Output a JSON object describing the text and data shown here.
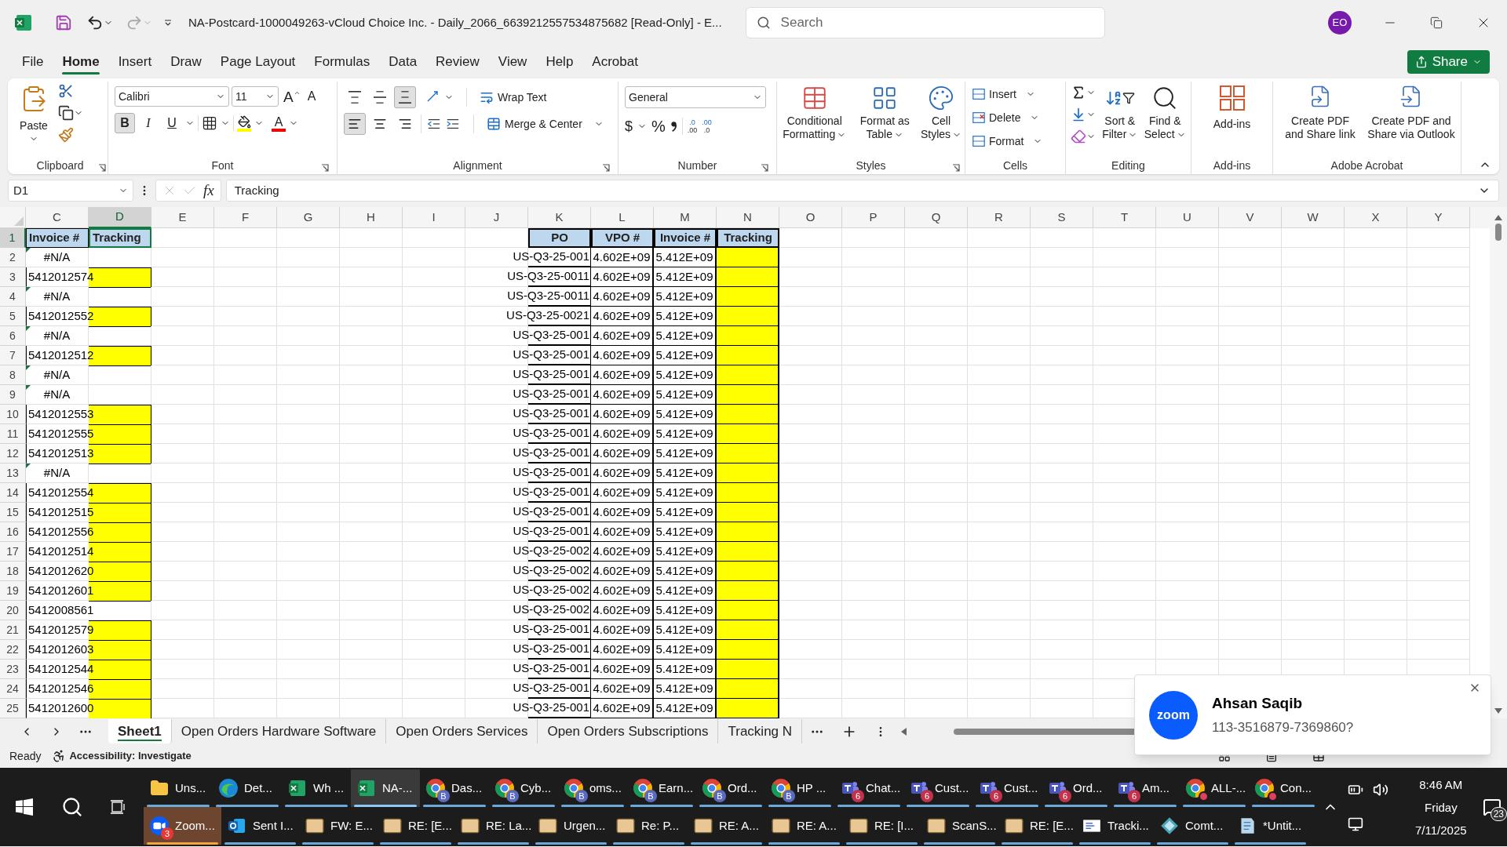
{
  "window": {
    "title": "NA-Postcard-1000049263-vCloud Choice Inc. - Daily_2066_6639212557534875682  [Read-Only]  -  E...",
    "search": {
      "placeholder": "Search"
    },
    "account": {
      "initials": "EO"
    }
  },
  "ribbon_tabs": [
    {
      "label": "File",
      "selected": false
    },
    {
      "label": "Home",
      "selected": true
    },
    {
      "label": "Insert",
      "selected": false
    },
    {
      "label": "Draw",
      "selected": false
    },
    {
      "label": "Page Layout",
      "selected": false
    },
    {
      "label": "Formulas",
      "selected": false
    },
    {
      "label": "Data",
      "selected": false
    },
    {
      "label": "Review",
      "selected": false
    },
    {
      "label": "View",
      "selected": false
    },
    {
      "label": "Help",
      "selected": false
    },
    {
      "label": "Acrobat",
      "selected": false
    }
  ],
  "share_button": "Share",
  "ribbon": {
    "clipboard": {
      "label": "Clipboard",
      "paste": "Paste"
    },
    "font": {
      "label": "Font",
      "font_name": "Calibri",
      "font_size": "11",
      "grow": "A",
      "shrink": "A",
      "font_color_letter": "A",
      "styles": [
        {
          "kind": "bold",
          "letter": "B",
          "selected": true
        },
        {
          "kind": "italic",
          "letter": "I",
          "selected": false
        },
        {
          "kind": "underline",
          "letter": "U",
          "selected": false
        }
      ]
    },
    "alignment": {
      "label": "Alignment",
      "vertical": [
        {
          "kind": "top",
          "selected": false
        },
        {
          "kind": "middle",
          "selected": false
        },
        {
          "kind": "bottom",
          "selected": true
        }
      ],
      "horizontal": [
        {
          "kind": "left",
          "selected": true
        },
        {
          "kind": "center",
          "selected": false
        },
        {
          "kind": "right",
          "selected": false
        }
      ],
      "wrap_text": "Wrap Text",
      "merge_center": "Merge & Center"
    },
    "number": {
      "label": "Number",
      "format": "General",
      "currency": "$",
      "percent": "%",
      "decimals": [
        {
          "top": ".0",
          "bottom": ".00"
        },
        {
          "top": ".00",
          "bottom": ".0"
        }
      ]
    },
    "styles": {
      "label": "Styles",
      "buttons": [
        {
          "kind": "conditional",
          "lines": [
            "Conditional",
            "Formatting"
          ]
        },
        {
          "kind": "table",
          "lines": [
            "Format as",
            "Table"
          ]
        },
        {
          "kind": "cell",
          "lines": [
            "Cell",
            "Styles"
          ]
        }
      ]
    },
    "cells": {
      "label": "Cells",
      "buttons": [
        {
          "kind": "insert",
          "label": "Insert"
        },
        {
          "kind": "delete",
          "label": "Delete"
        },
        {
          "kind": "format",
          "label": "Format"
        }
      ]
    },
    "editing": {
      "label": "Editing",
      "buttons": [
        {
          "kind": "sort",
          "lines": [
            "Sort &",
            "Filter"
          ]
        },
        {
          "kind": "find",
          "lines": [
            "Find &",
            "Select"
          ]
        }
      ]
    },
    "addins": {
      "label": "Add-ins",
      "button": "Add-ins"
    },
    "acrobat": {
      "label": "Adobe Acrobat",
      "buttons": [
        {
          "kind": "link",
          "lines": [
            "Create PDF",
            "and Share link"
          ]
        },
        {
          "kind": "outlook",
          "lines": [
            "Create PDF and",
            "Share via Outlook"
          ]
        }
      ]
    }
  },
  "formula_bar": {
    "name_box": "D1",
    "fx": "fx",
    "formula": "Tracking"
  },
  "columns": [
    {
      "label": "C",
      "selected": false
    },
    {
      "label": "D",
      "selected": true
    },
    {
      "label": "E",
      "selected": false
    },
    {
      "label": "F",
      "selected": false
    },
    {
      "label": "G",
      "selected": false
    },
    {
      "label": "H",
      "selected": false
    },
    {
      "label": "I",
      "selected": false
    },
    {
      "label": "J",
      "selected": false
    },
    {
      "label": "K",
      "selected": false
    },
    {
      "label": "L",
      "selected": false
    },
    {
      "label": "M",
      "selected": false
    },
    {
      "label": "N",
      "selected": false
    },
    {
      "label": "O",
      "selected": false
    },
    {
      "label": "P",
      "selected": false
    },
    {
      "label": "Q",
      "selected": false
    },
    {
      "label": "R",
      "selected": false
    },
    {
      "label": "S",
      "selected": false
    },
    {
      "label": "T",
      "selected": false
    },
    {
      "label": "U",
      "selected": false
    },
    {
      "label": "V",
      "selected": false
    },
    {
      "label": "W",
      "selected": false
    },
    {
      "label": "X",
      "selected": false
    },
    {
      "label": "Y",
      "selected": false
    }
  ],
  "header_row": {
    "number": "1",
    "selected": true,
    "left": [
      {
        "text": "Invoice #",
        "selected": false
      },
      {
        "text": "Tracking",
        "selected": true
      }
    ],
    "right": [
      "PO",
      "VPO #",
      "Invoice #",
      "Tracking"
    ]
  },
  "rows": [
    {
      "number": "2",
      "invoice": "#N/A",
      "kind": "error",
      "tracking_filled": false,
      "po": "US-Q3-25-001",
      "vpo": "4.602E+09",
      "invoice_2": "5.412E+09",
      "tracking_2_filled": true
    },
    {
      "number": "3",
      "invoice": "5412012574",
      "kind": "number",
      "tracking_filled": true,
      "po": "US-Q3-25-0011",
      "vpo": "4.602E+09",
      "invoice_2": "5.412E+09",
      "tracking_2_filled": true
    },
    {
      "number": "4",
      "invoice": "#N/A",
      "kind": "error",
      "tracking_filled": false,
      "po": "US-Q3-25-0011",
      "vpo": "4.602E+09",
      "invoice_2": "5.412E+09",
      "tracking_2_filled": true
    },
    {
      "number": "5",
      "invoice": "5412012552",
      "kind": "number",
      "tracking_filled": true,
      "po": "US-Q3-25-0021",
      "vpo": "4.602E+09",
      "invoice_2": "5.412E+09",
      "tracking_2_filled": true
    },
    {
      "number": "6",
      "invoice": "#N/A",
      "kind": "error",
      "tracking_filled": false,
      "po": "US-Q3-25-001",
      "vpo": "4.602E+09",
      "invoice_2": "5.412E+09",
      "tracking_2_filled": true
    },
    {
      "number": "7",
      "invoice": "5412012512",
      "kind": "number",
      "tracking_filled": true,
      "po": "US-Q3-25-001",
      "vpo": "4.602E+09",
      "invoice_2": "5.412E+09",
      "tracking_2_filled": true
    },
    {
      "number": "8",
      "invoice": "#N/A",
      "kind": "error",
      "tracking_filled": false,
      "po": "US-Q3-25-001",
      "vpo": "4.602E+09",
      "invoice_2": "5.412E+09",
      "tracking_2_filled": true
    },
    {
      "number": "9",
      "invoice": "#N/A",
      "kind": "error",
      "tracking_filled": false,
      "po": "US-Q3-25-001",
      "vpo": "4.602E+09",
      "invoice_2": "5.412E+09",
      "tracking_2_filled": true
    },
    {
      "number": "10",
      "invoice": "5412012553",
      "kind": "number",
      "tracking_filled": true,
      "po": "US-Q3-25-001",
      "vpo": "4.602E+09",
      "invoice_2": "5.412E+09",
      "tracking_2_filled": true
    },
    {
      "number": "11",
      "invoice": "5412012555",
      "kind": "number",
      "tracking_filled": true,
      "po": "US-Q3-25-001",
      "vpo": "4.602E+09",
      "invoice_2": "5.412E+09",
      "tracking_2_filled": true
    },
    {
      "number": "12",
      "invoice": "5412012513",
      "kind": "number",
      "tracking_filled": true,
      "po": "US-Q3-25-001",
      "vpo": "4.602E+09",
      "invoice_2": "5.412E+09",
      "tracking_2_filled": true
    },
    {
      "number": "13",
      "invoice": "#N/A",
      "kind": "error",
      "tracking_filled": false,
      "po": "US-Q3-25-001",
      "vpo": "4.602E+09",
      "invoice_2": "5.412E+09",
      "tracking_2_filled": true
    },
    {
      "number": "14",
      "invoice": "5412012554",
      "kind": "number",
      "tracking_filled": true,
      "po": "US-Q3-25-001",
      "vpo": "4.602E+09",
      "invoice_2": "5.412E+09",
      "tracking_2_filled": true
    },
    {
      "number": "15",
      "invoice": "5412012515",
      "kind": "number",
      "tracking_filled": true,
      "po": "US-Q3-25-001",
      "vpo": "4.602E+09",
      "invoice_2": "5.412E+09",
      "tracking_2_filled": true
    },
    {
      "number": "16",
      "invoice": "5412012556",
      "kind": "number",
      "tracking_filled": true,
      "po": "US-Q3-25-001",
      "vpo": "4.602E+09",
      "invoice_2": "5.412E+09",
      "tracking_2_filled": true
    },
    {
      "number": "17",
      "invoice": "5412012514",
      "kind": "number",
      "tracking_filled": true,
      "po": "US-Q3-25-002",
      "vpo": "4.602E+09",
      "invoice_2": "5.412E+09",
      "tracking_2_filled": true
    },
    {
      "number": "18",
      "invoice": "5412012620",
      "kind": "number",
      "tracking_filled": true,
      "po": "US-Q3-25-002",
      "vpo": "4.602E+09",
      "invoice_2": "5.412E+09",
      "tracking_2_filled": true
    },
    {
      "number": "19",
      "invoice": "5412012601",
      "kind": "number",
      "tracking_filled": true,
      "po": "US-Q3-25-002",
      "vpo": "4.602E+09",
      "invoice_2": "5.412E+09",
      "tracking_2_filled": true
    },
    {
      "number": "20",
      "invoice": "5412008561",
      "kind": "number",
      "tracking_filled": false,
      "po": "US-Q3-25-002",
      "vpo": "4.602E+09",
      "invoice_2": "5.412E+09",
      "tracking_2_filled": true
    },
    {
      "number": "21",
      "invoice": "5412012579",
      "kind": "number",
      "tracking_filled": true,
      "po": "US-Q3-25-001",
      "vpo": "4.602E+09",
      "invoice_2": "5.412E+09",
      "tracking_2_filled": true
    },
    {
      "number": "22",
      "invoice": "5412012603",
      "kind": "number",
      "tracking_filled": true,
      "po": "US-Q3-25-001",
      "vpo": "4.602E+09",
      "invoice_2": "5.412E+09",
      "tracking_2_filled": true
    },
    {
      "number": "23",
      "invoice": "5412012544",
      "kind": "number",
      "tracking_filled": true,
      "po": "US-Q3-25-001",
      "vpo": "4.602E+09",
      "invoice_2": "5.412E+09",
      "tracking_2_filled": true
    },
    {
      "number": "24",
      "invoice": "5412012546",
      "kind": "number",
      "tracking_filled": true,
      "po": "US-Q3-25-001",
      "vpo": "4.602E+09",
      "invoice_2": "5.412E+09",
      "tracking_2_filled": true
    },
    {
      "number": "25",
      "invoice": "5412012600",
      "kind": "number",
      "tracking_filled": true,
      "po": "US-Q3-25-001",
      "vpo": "4.602E+09",
      "invoice_2": "5.412E+09",
      "tracking_2_filled": true
    }
  ],
  "sheet_tabs": [
    {
      "label": "Sheet1",
      "selected": true
    },
    {
      "label": "Open Orders Hardware Software",
      "selected": false
    },
    {
      "label": "Open Orders Services",
      "selected": false
    },
    {
      "label": "Open Orders Subscriptions",
      "selected": false
    },
    {
      "label": "Tracking N",
      "selected": false
    }
  ],
  "status_bar": {
    "ready": "Ready",
    "accessibility": "Accessibility: Investigate"
  },
  "notification": {
    "logo": "zoom",
    "sender": "Ahsan Saqib",
    "message": "113-3516879-7369860?"
  },
  "taskbar": {
    "row_1": [
      {
        "kind": "folder",
        "label": "Uns...",
        "selected": false,
        "flashing": false
      },
      {
        "kind": "edge",
        "label": "Det...",
        "selected": false,
        "flashing": false
      },
      {
        "kind": "excel",
        "label": "Wh ...",
        "selected": false,
        "flashing": false
      },
      {
        "kind": "excel",
        "label": "NA-...",
        "selected": true,
        "flashing": false
      },
      {
        "kind": "chrome",
        "label": "Das...",
        "badge": "B",
        "selected": false,
        "flashing": false
      },
      {
        "kind": "chrome",
        "label": "Cyb...",
        "badge": "B",
        "selected": false,
        "flashing": false
      },
      {
        "kind": "chrome",
        "label": "oms...",
        "badge": "B",
        "selected": false,
        "flashing": false
      },
      {
        "kind": "chrome",
        "label": "Earn...",
        "badge": "B",
        "selected": false,
        "flashing": false
      },
      {
        "kind": "chrome",
        "label": "Ord...",
        "badge": "B",
        "selected": false,
        "flashing": false
      },
      {
        "kind": "chrome",
        "label": "HP ...",
        "badge": "B",
        "selected": false,
        "flashing": false
      },
      {
        "kind": "teams",
        "label": "Chat...",
        "badge": "6",
        "selected": false,
        "flashing": false
      },
      {
        "kind": "teams",
        "label": "Cust...",
        "badge": "6",
        "selected": false,
        "flashing": false
      },
      {
        "kind": "teams",
        "label": "Cust...",
        "badge": "6",
        "selected": false,
        "flashing": false
      },
      {
        "kind": "teams",
        "label": "Ord...",
        "badge": "6",
        "selected": false,
        "flashing": false
      },
      {
        "kind": "teams",
        "label": "Am...",
        "badge": "6",
        "selected": false,
        "flashing": false
      },
      {
        "kind": "chrome_avatar",
        "label": "ALL-...",
        "selected": false,
        "flashing": false
      },
      {
        "kind": "chrome_avatar",
        "label": "Con...",
        "selected": false,
        "flashing": false
      }
    ],
    "row_2": [
      {
        "kind": "zoom",
        "label": "Zoom...",
        "badge": "3",
        "selected": false,
        "flashing": true
      },
      {
        "kind": "outlook",
        "label": "Sent I...",
        "selected": false,
        "flashing": false
      },
      {
        "kind": "mail",
        "label": "FW: E...",
        "selected": false,
        "flashing": false
      },
      {
        "kind": "mail",
        "label": "RE: [E...",
        "selected": false,
        "flashing": false
      },
      {
        "kind": "mail",
        "label": "RE: La...",
        "selected": false,
        "flashing": false
      },
      {
        "kind": "mail",
        "label": "Urgen...",
        "selected": false,
        "flashing": false
      },
      {
        "kind": "mail",
        "label": "Re: P...",
        "selected": false,
        "flashing": false
      },
      {
        "kind": "mail",
        "label": "RE: A...",
        "selected": false,
        "flashing": false
      },
      {
        "kind": "mail",
        "label": "RE: A...",
        "selected": false,
        "flashing": false
      },
      {
        "kind": "mail",
        "label": "RE: [I...",
        "selected": false,
        "flashing": false
      },
      {
        "kind": "mail",
        "label": "ScanS...",
        "selected": false,
        "flashing": false
      },
      {
        "kind": "mail",
        "label": "RE: [E...",
        "selected": false,
        "flashing": false
      },
      {
        "kind": "document",
        "label": "Tracki...",
        "selected": false,
        "flashing": false
      },
      {
        "kind": "gem",
        "label": "Comt...",
        "selected": false,
        "flashing": false
      },
      {
        "kind": "notepad",
        "label": "*Untit...",
        "selected": false,
        "flashing": false
      }
    ],
    "clock": {
      "time": "8:46 AM",
      "day": "Friday",
      "date": "7/11/2025"
    },
    "notifications_count": "23"
  }
}
